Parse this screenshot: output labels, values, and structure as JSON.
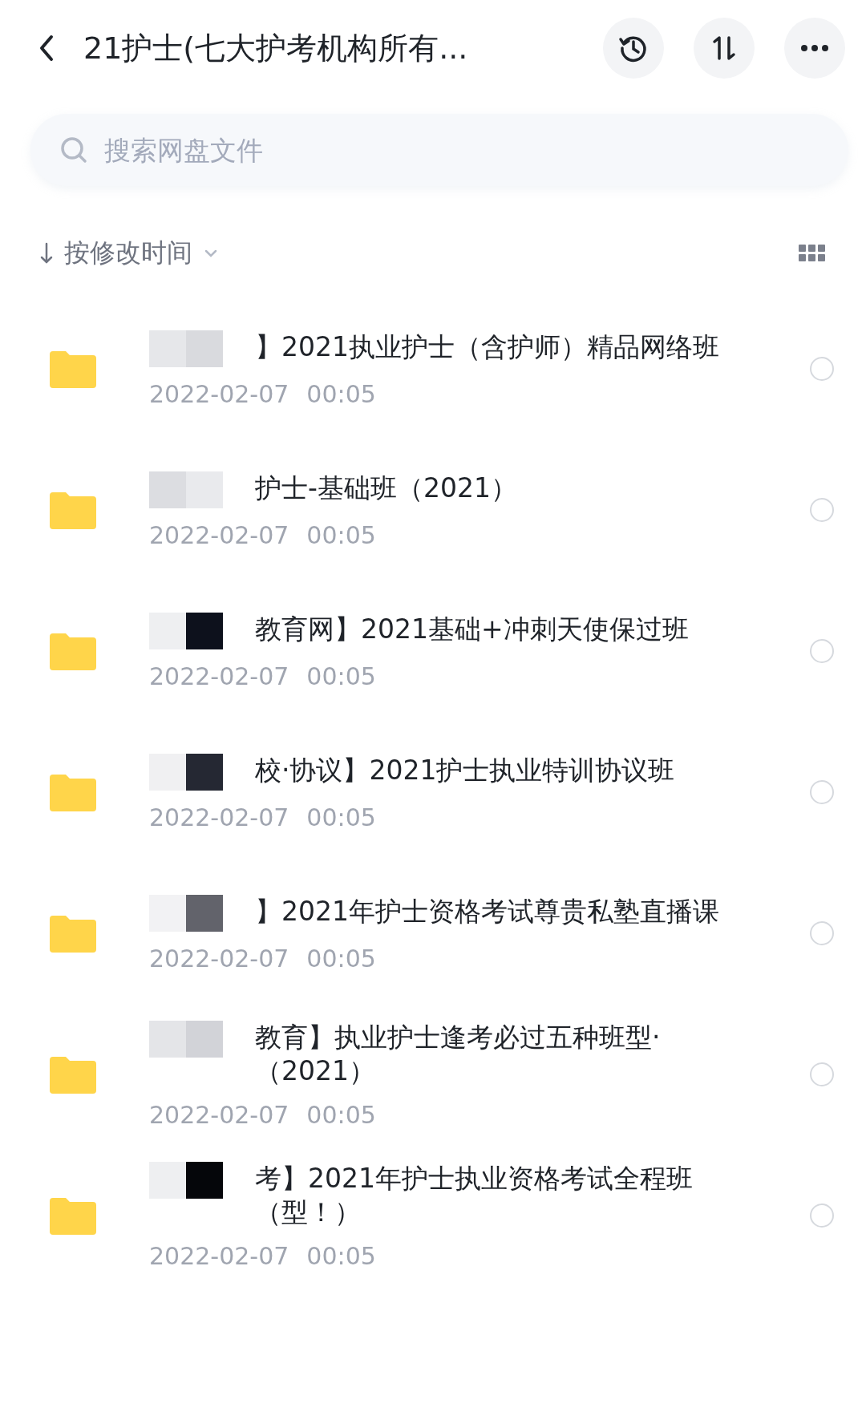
{
  "header": {
    "title": "21护士(七大护考机构所有..."
  },
  "search": {
    "placeholder": "搜索网盘文件"
  },
  "sort": {
    "label": "按修改时间"
  },
  "files": [
    {
      "name": "】2021执业护士（含护师）精品网络班",
      "date": "2022-02-07",
      "time": "00:05",
      "selected": false
    },
    {
      "name": "护士-基础班（2021）",
      "date": "2022-02-07",
      "time": "00:05",
      "selected": false
    },
    {
      "name": "教育网】2021基础+冲刺天使保过班",
      "date": "2022-02-07",
      "time": "00:05",
      "selected": false
    },
    {
      "name": "校·协议】2021护士执业特训协议班",
      "date": "2022-02-07",
      "time": "00:05",
      "selected": false
    },
    {
      "name": "】2021年护士资格考试尊贵私塾直播课",
      "date": "2022-02-07",
      "time": "00:05",
      "selected": false
    },
    {
      "name": "教育】执业护士逢考必过五种班型·（2021）",
      "date": "2022-02-07",
      "time": "00:05",
      "selected": false
    },
    {
      "name": "考】2021年护士执业资格考试全程班（型！）",
      "date": "2022-02-07",
      "time": "00:05",
      "selected": false
    }
  ]
}
